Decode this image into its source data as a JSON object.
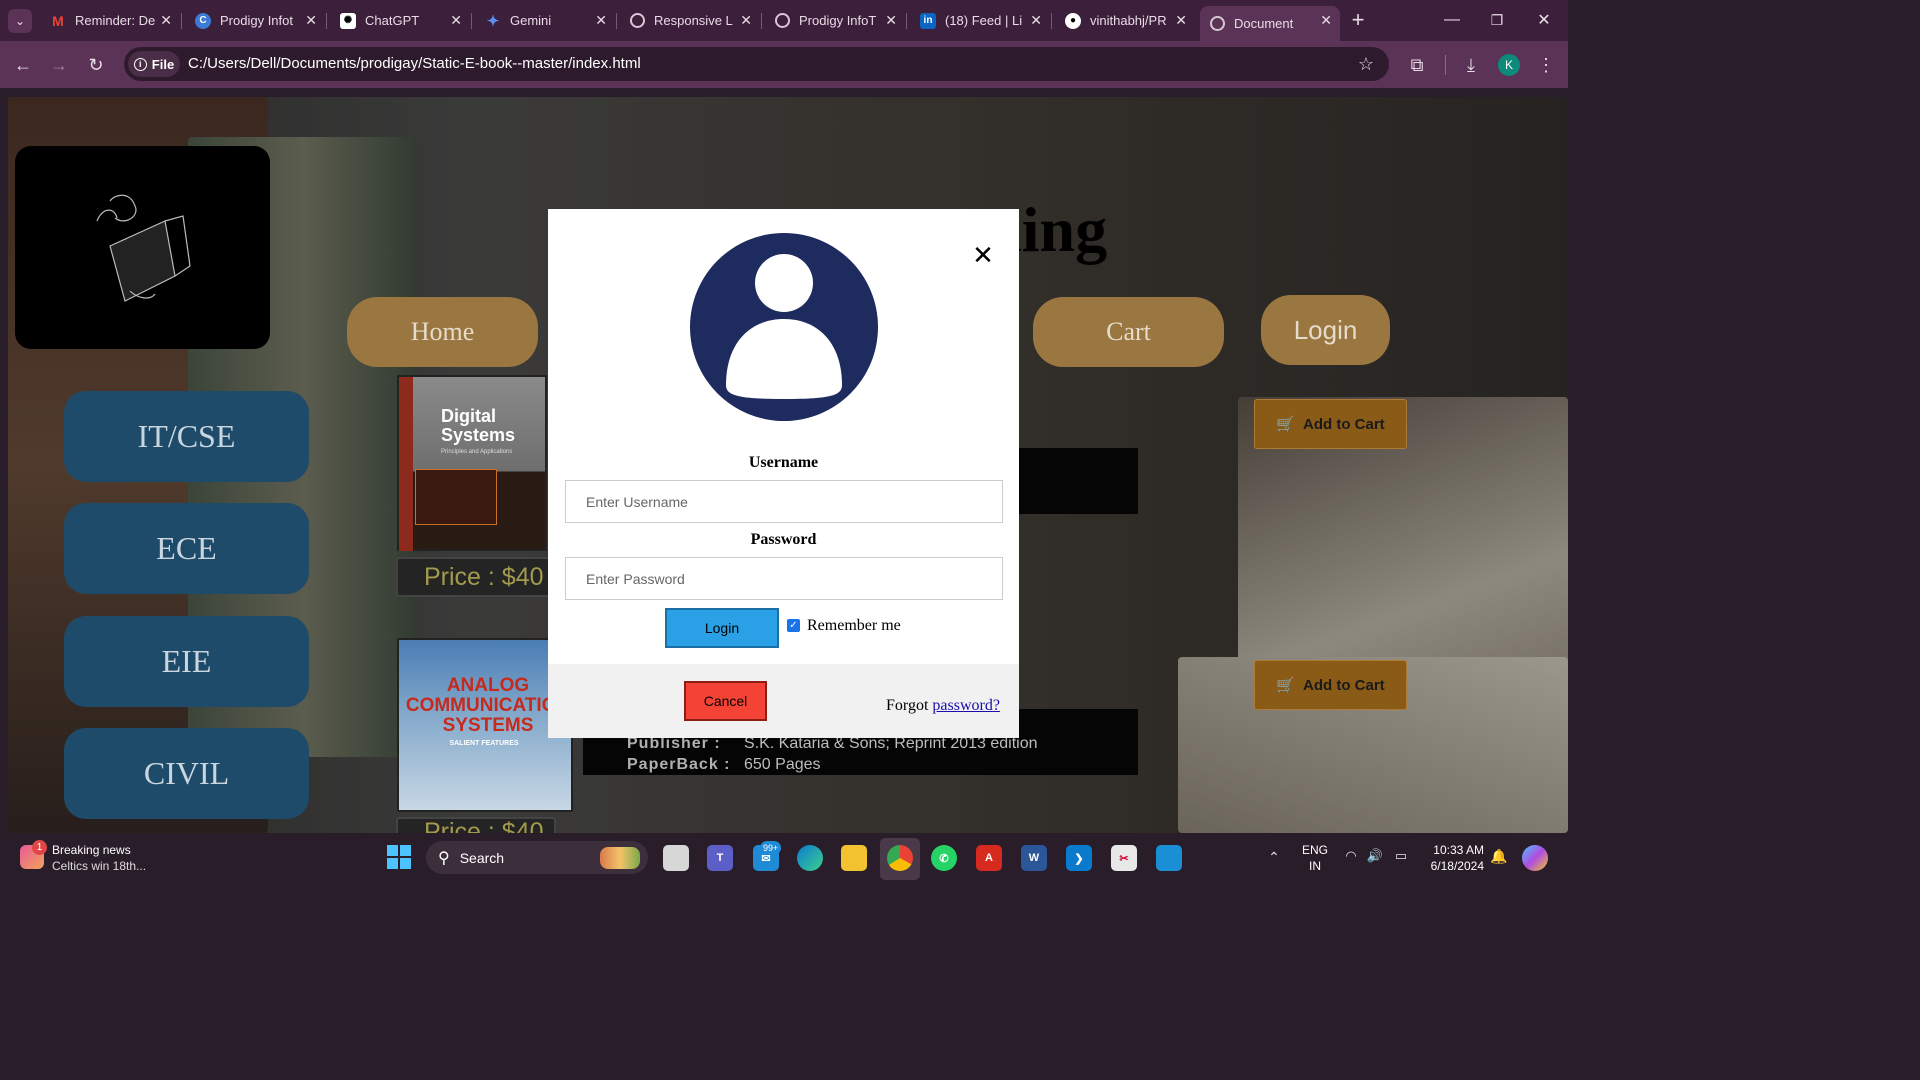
{
  "browser": {
    "tabs": [
      {
        "title": "Reminder: De",
        "icon": "gmail-icon"
      },
      {
        "title": "Prodigy Infot",
        "icon": "prodigy-icon"
      },
      {
        "title": "ChatGPT",
        "icon": "chatgpt-icon"
      },
      {
        "title": "Gemini",
        "icon": "gemini-icon"
      },
      {
        "title": "Responsive L",
        "icon": "globe-icon"
      },
      {
        "title": "Prodigy InfoT",
        "icon": "globe-icon"
      },
      {
        "title": "(18) Feed | Li",
        "icon": "linkedin-icon"
      },
      {
        "title": "vinithabhj/PR",
        "icon": "github-icon"
      },
      {
        "title": "Document",
        "icon": "globe-icon"
      }
    ],
    "scheme_label": "File",
    "url": "C:/Users/Dell/Documents/prodigay/Static-E-book--master/index.html",
    "profile_initial": "K"
  },
  "site": {
    "heading": "Learning",
    "nav": {
      "home": "Home",
      "cart": "Cart",
      "login": "Login"
    },
    "sidebar": [
      "IT/CSE",
      "ECE",
      "EIE",
      "CIVIL"
    ],
    "add_to_cart": "Add to Cart",
    "books": [
      {
        "title": "Digital Systems",
        "subtitle": "Principles and Applications",
        "price": "Price : $40"
      },
      {
        "title": "ANALOG COMMUNICATION SYSTEMS",
        "subtitle": "SALIENT FEATURES",
        "price": "Price : $40"
      }
    ],
    "book2_info": {
      "publisher_label": "Publisher :",
      "publisher": "S.K. Kataria & Sons; Reprint 2013 edition",
      "paperback_label": "PaperBack :",
      "paperback": "650 Pages"
    }
  },
  "modal": {
    "username_label": "Username",
    "username_placeholder": "Enter Username",
    "password_label": "Password",
    "password_placeholder": "Enter Password",
    "login_button": "Login",
    "remember_label": "Remember me",
    "remember_checked": true,
    "cancel_button": "Cancel",
    "forgot_text": "Forgot",
    "forgot_link": "password?"
  },
  "taskbar": {
    "news_title": "Breaking news",
    "news_sub": "Celtics win 18th...",
    "news_badge": "1",
    "search_label": "Search",
    "mail_badge": "99+",
    "language": "ENG",
    "region": "IN",
    "time": "10:33 AM",
    "date": "6/18/2024"
  },
  "colors": {
    "avatar": "#1d2b5e",
    "login_btn": "#2aa1e6",
    "cancel_btn": "#f44336",
    "nav_btn": "#9a7640",
    "side_btn": "#1f4b6a"
  }
}
